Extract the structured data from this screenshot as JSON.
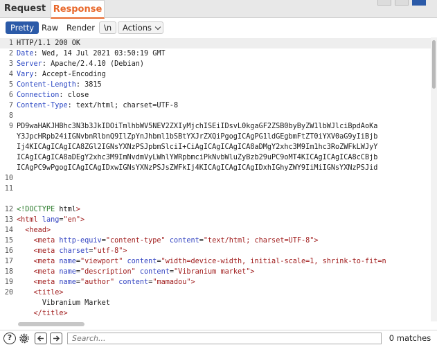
{
  "tabs": {
    "request": "Request",
    "response": "Response"
  },
  "toolbar": {
    "pretty": "Pretty",
    "raw": "Raw",
    "render": "Render",
    "newline": "\\n",
    "actions": "Actions"
  },
  "headers": [
    {
      "n": "1",
      "text": "HTTP/1.1 200 OK"
    },
    {
      "n": "2",
      "key": "Date",
      "value": " Wed, 14 Jul 2021 03:50:19 GMT"
    },
    {
      "n": "3",
      "key": "Server",
      "value": " Apache/2.4.10 (Debian)"
    },
    {
      "n": "4",
      "key": "Vary",
      "value": " Accept-Encoding"
    },
    {
      "n": "5",
      "key": "Content-Length",
      "value": " 3815"
    },
    {
      "n": "6",
      "key": "Connection",
      "value": " close"
    },
    {
      "n": "7",
      "key": "Content-Type",
      "value": " text/html; charset=UTF-8"
    }
  ],
  "blank8": "8",
  "base64": {
    "n": "9",
    "lines": [
      "PD9waHAKJHBhc3N3b3JkIDOiTmlhbWV5NEV2ZXIyMjchISEiIDsvL0kgaGF2ZSB0byByZW1lbWJlciBpdAoKa",
      "Y3JpcHRpb24iIGNvbnRlbnQ9IlZpYnJhbml1bSBtYXJrZXQiPgogICAgPG1ldGEgbmFtZT0iYXV0aG9yIiBjb",
      "Ij4KICAgICAgICA8ZGl2IGNsYXNzPSJpbmSlciI+CiAgICAgICAgICA8aDMgY2xhc3M9Im1hc3RoZWFkLWJyY",
      "ICAgICAgICA8aDEgY2xhc3M9ImNvdmVyLWhlYWRpbmciPkNvbWluZyBzb29uPC9oMT4KICAgICAgICA8cCBjb",
      "ICAgPC9wPgogICAgICAgIDxwIGNsYXNzPSJsZWFkIj4KICAgICAgICAgIDxhIGhyZWY9IiMiIGNsYXNzPSJid"
    ]
  },
  "blank": [
    "10",
    "11"
  ],
  "html": [
    {
      "n": "12",
      "doctype": "<!DOCTYPE",
      "rest": " html",
      "close": ">",
      "indent": ""
    },
    {
      "n": "13",
      "open": "<html",
      "attrs": [
        {
          "a": "lang",
          "v": "\"en\""
        }
      ],
      "close": ">",
      "indent": ""
    },
    {
      "n": "14",
      "open": "<head",
      "attrs": [],
      "close": ">",
      "indent": "  "
    },
    {
      "n": "15",
      "open": "<meta",
      "attrs": [
        {
          "a": "http-equiv",
          "v": "\"content-type\""
        },
        {
          "a": "content",
          "v": "\"text/html; charset=UTF-8\""
        }
      ],
      "close": ">",
      "indent": "    "
    },
    {
      "n": "16",
      "open": "<meta",
      "attrs": [
        {
          "a": "charset",
          "v": "\"utf-8\""
        }
      ],
      "close": ">",
      "indent": "    "
    },
    {
      "n": "17",
      "open": "<meta",
      "attrs": [
        {
          "a": "name",
          "v": "\"viewport\""
        },
        {
          "a": "content",
          "v": "\"width=device-width, initial-scale=1, shrink-to-fit=n"
        }
      ],
      "close": "",
      "indent": "    "
    },
    {
      "n": "18",
      "open": "<meta",
      "attrs": [
        {
          "a": "name",
          "v": "\"description\""
        },
        {
          "a": "content",
          "v": "\"Vibranium market\""
        }
      ],
      "close": ">",
      "indent": "    "
    },
    {
      "n": "19",
      "open": "<meta",
      "attrs": [
        {
          "a": "name",
          "v": "\"author\""
        },
        {
          "a": "content",
          "v": "\"mamadou\""
        }
      ],
      "close": ">",
      "indent": "    "
    },
    {
      "n": "20",
      "open": "<title",
      "attrs": [],
      "close": ">",
      "indent": "    "
    },
    {
      "n": "",
      "textline": "Vibranium Market",
      "indent": "      "
    },
    {
      "n": "",
      "open": "</title",
      "attrs": [],
      "close": ">",
      "indent": "    "
    }
  ],
  "search": {
    "placeholder": "Search..."
  },
  "matches": "0 matches",
  "icons": {
    "help": "?",
    "settings": "gear-icon",
    "prev": "arrow-left-icon",
    "next": "arrow-right-icon"
  },
  "colors": {
    "accent": "#e8672a",
    "selected": "#2b5aa8"
  }
}
